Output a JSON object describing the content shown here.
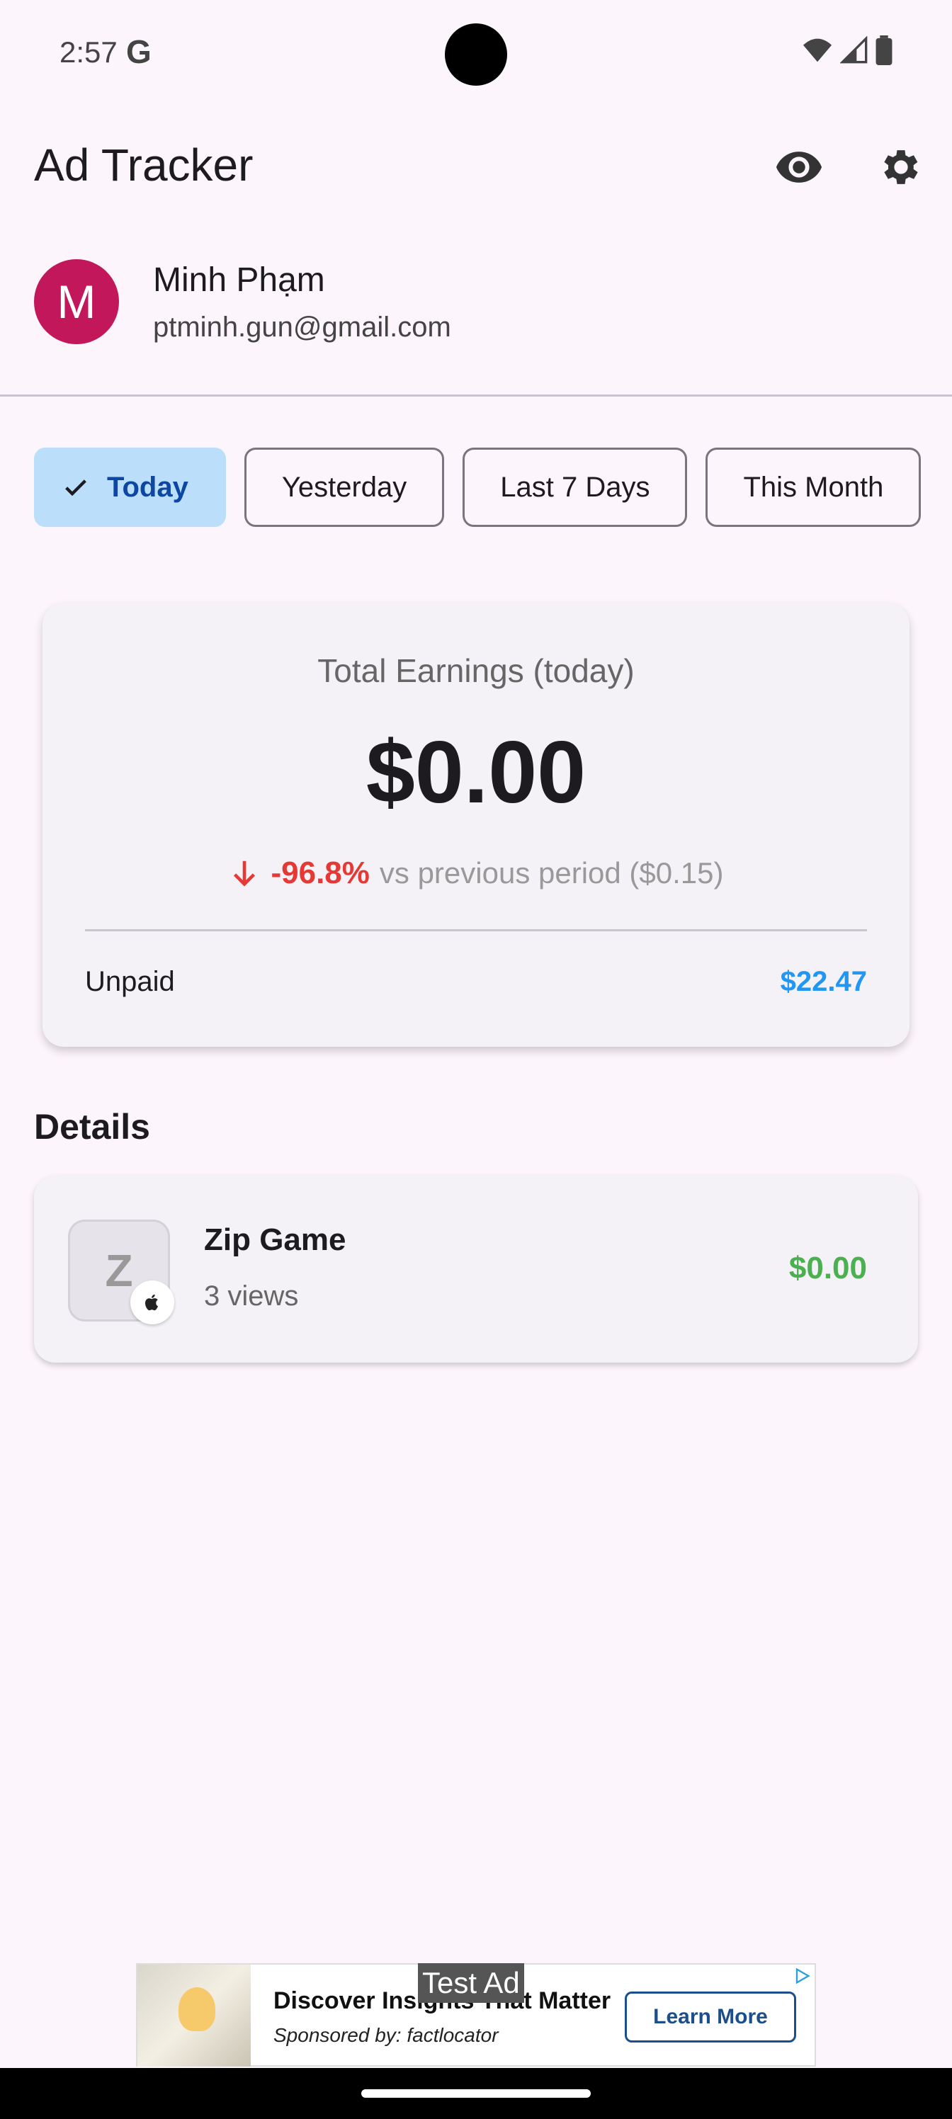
{
  "status_bar": {
    "time": "2:57",
    "g_logo": "G"
  },
  "app_bar": {
    "title": "Ad Tracker",
    "icons": [
      "eye-icon",
      "gear-icon"
    ]
  },
  "account": {
    "initial": "M",
    "name": "Minh Phạm",
    "email": "ptminh.gun@gmail.com",
    "avatar_color": "#c2185b"
  },
  "filters": {
    "chips": [
      {
        "label": "Today",
        "selected": true
      },
      {
        "label": "Yesterday",
        "selected": false
      },
      {
        "label": "Last 7 Days",
        "selected": false
      },
      {
        "label": "This Month",
        "selected": false
      }
    ]
  },
  "summary": {
    "label": "Total Earnings (today)",
    "amount": "$0.00",
    "delta": "-96.8%",
    "delta_text": "vs previous period ($0.15)",
    "unpaid_label": "Unpaid",
    "unpaid_value": "$22.47"
  },
  "details": {
    "title": "Details",
    "items": [
      {
        "icon_letter": "Z",
        "name": "Zip Game",
        "views": "3 views",
        "earnings": "$0.00",
        "platform": "apple-icon"
      }
    ]
  },
  "ad": {
    "test_label": "Test Ad",
    "headline": "Discover Insights That Matter",
    "sponsor": "Sponsored by: factlocator",
    "cta": "Learn More"
  },
  "colors": {
    "accent": "#2196f3",
    "negative": "#e53935",
    "positive": "#4caf50",
    "chip_selected": "#bbdefb",
    "background": "#fcf5fb"
  }
}
